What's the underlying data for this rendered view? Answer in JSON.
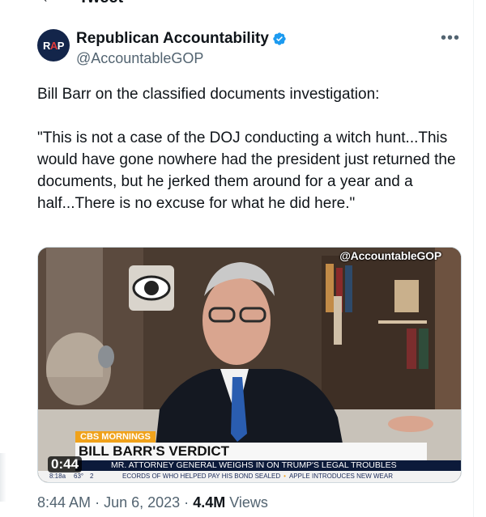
{
  "header": {
    "title": "Tweet"
  },
  "author": {
    "name": "Republican Accountability",
    "handle": "@AccountableGOP",
    "avatar_text": {
      "r": "R",
      "a": "A",
      "p": "P"
    },
    "verified_color": "#1d9bf0"
  },
  "tweet": {
    "text": "Bill Barr on the classified documents investigation:\n\n\"This is not a case of the DOJ conducting a witch hunt...This would have gone nowhere had the president just returned the documents, but he jerked them around for a year and a half...There is no excuse for what he did here.\""
  },
  "media": {
    "watermark": "@AccountableGOP",
    "show_tag": "CBS MORNINGS",
    "headline": "BILL BARR'S VERDICT",
    "subheadline": "MR. ATTORNEY GENERAL WEIGHS IN ON TRUMP'S LEGAL TROUBLES",
    "ticker_time": "8:18a",
    "ticker_temp": "63°",
    "ticker_network": "2",
    "ticker_headline_1": "ECORDS OF WHO HELPED PAY HIS BOND SEALED",
    "ticker_headline_2": "APPLE INTRODUCES NEW WEAR",
    "duration": "0:44"
  },
  "meta": {
    "time": "8:44 AM",
    "date": "Jun 6, 2023",
    "separator": "·",
    "views_count": "4.4M",
    "views_label": "Views"
  },
  "colors": {
    "accent": "#1d9bf0",
    "text": "#0f1419",
    "muted": "#536471"
  }
}
